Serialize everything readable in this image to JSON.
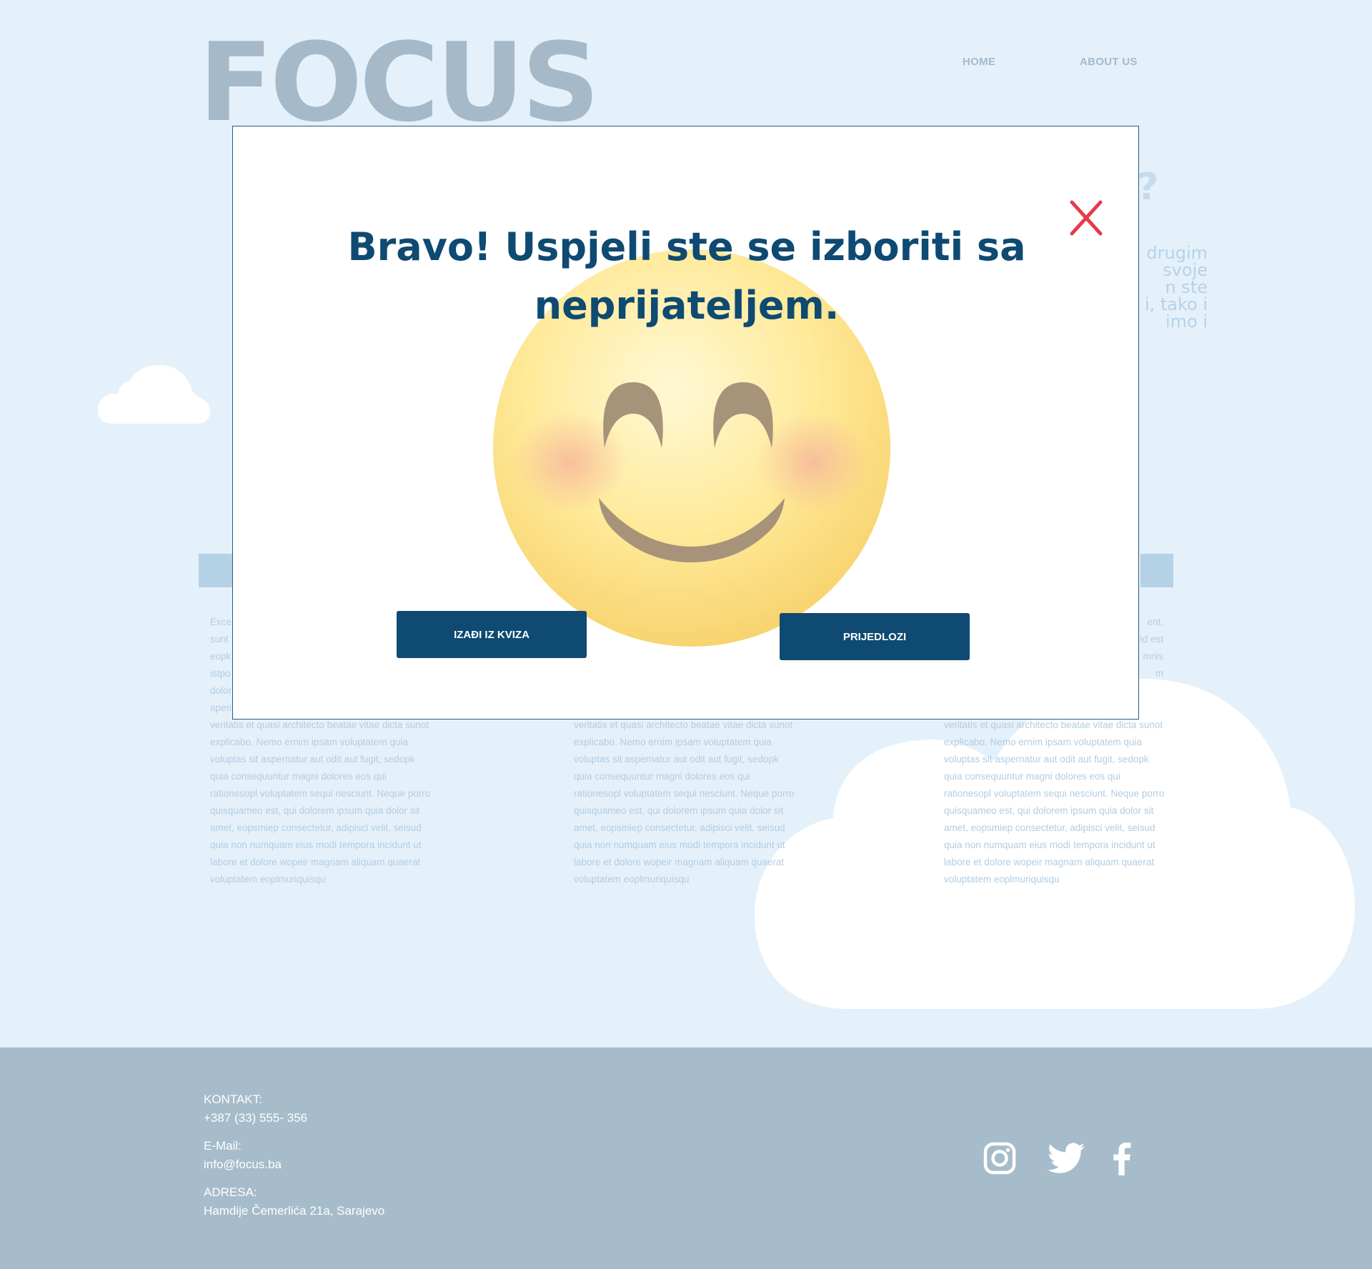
{
  "header": {
    "logo": "FOCUS",
    "nav": {
      "home": "HOME",
      "about": "ABOUT US"
    }
  },
  "background": {
    "heading_fragment": "s?",
    "para_lines": [
      "drugim",
      "svoje",
      "n ste",
      "i, tako i",
      "imo i"
    ]
  },
  "columns": [
    {
      "visible_fragments": [
        "Exce",
        "sunt",
        "eopk",
        "istpo",
        "dolor",
        "aperi"
      ],
      "text": "veritatis et quasi architecto beatae vitae dicta sunot explicabo. Nemo ernim ipsam voluptatem quia voluptas sit aspernatur aut odit aut fugit, sedopk quia consequuntur magni dolores eos qui rationesopl voluptatem sequi nesciunt. Neque porro quisquameo est, qui dolorem ipsum quia dolor sit amet, eopsmiep consectetur, adipisci velit, seisud quia non numquam eius modi tempora incidunt ut labore et dolore wopeir magnam aliquam quaerat voluptatem eoplmuriquisqu"
    },
    {
      "text": "veritatis et quasi architecto beatae vitae dicta sunot explicabo. Nemo ernim ipsam voluptatem quia voluptas sit aspernatur aut odit aut fugit, sedopk quia consequuntur magni dolores eos qui rationesopl voluptatem sequi nesciunt. Neque porro quisquameo est, qui dolorem ipsum quia dolor sit amet, eopsmiep consectetur, adipisci velit, seisud quia non numquam eius modi tempora incidunt ut labore et dolore wopeir magnam aliquam quaerat voluptatem eoplmuriquisqu"
    },
    {
      "visible_fragments": [
        "ent,",
        "id est",
        "mnis",
        "m"
      ],
      "text": "veritatis et quasi architecto beatae vitae dicta sunot explicabo. Nemo ernim ipsam voluptatem quia voluptas sit aspernatur aut odit aut fugit, sedopk quia consequuntur magni dolores eos qui rationesopl voluptatem sequi nesciunt. Neque porro quisquameo est, qui dolorem ipsum quia dolor sit amet, eopsmiep consectetur, adipisci velit, seisud quia non numquam eius modi tempora incidunt ut labore et dolore wopeir magnam aliquam quaerat voluptatem eoplmuriquisqu"
    }
  ],
  "footer": {
    "contact_label": "KONTAKT:",
    "contact_value": "+387 (33) 555- 356",
    "email_label": "E-Mail:",
    "email_value": "info@focus.ba",
    "address_label": "ADRESA:",
    "address_value": "Hamdije Čemerlića 21a, Sarajevo"
  },
  "modal": {
    "title": "Bravo! Uspjeli ste se izboriti sa neprijateljem.",
    "exit_button": "IZAĐI IZ KVIZA",
    "suggest_button": "PRIJEDLOZI"
  },
  "colors": {
    "page_bg": "#e4f1fb",
    "primary": "#0e4a72",
    "close": "#e8394b",
    "footer_bg": "#a6bccb"
  },
  "icons": [
    "close-icon",
    "smiling-emoji-icon",
    "instagram-icon",
    "twitter-icon",
    "facebook-icon",
    "cloud-icon"
  ]
}
